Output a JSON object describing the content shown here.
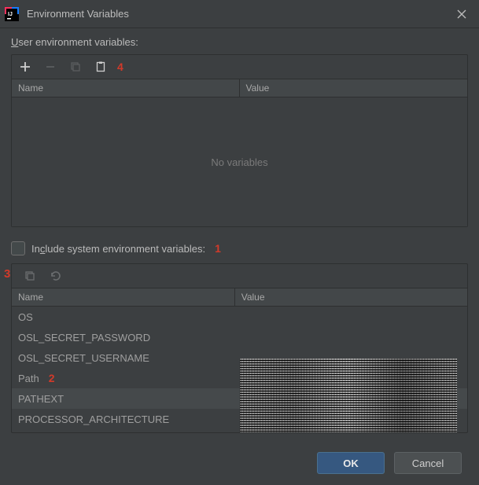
{
  "dialog": {
    "title": "Environment Variables",
    "app_icon_letters": "IJ"
  },
  "user_section": {
    "label_pre": "U",
    "label_post": "ser environment variables:",
    "columns": {
      "name": "Name",
      "value": "Value"
    },
    "empty_text": "No variables"
  },
  "include_checkbox": {
    "pre": "In",
    "underline": "c",
    "post": "lude system environment variables:"
  },
  "sys_section": {
    "columns": {
      "name": "Name",
      "value": "Value"
    },
    "rows": [
      {
        "name": "OS",
        "value": ""
      },
      {
        "name": "OSL_SECRET_PASSWORD",
        "value": ""
      },
      {
        "name": "OSL_SECRET_USERNAME",
        "value": ""
      },
      {
        "name": "Path",
        "value": ""
      },
      {
        "name": "PATHEXT",
        "value": "",
        "selected": true
      },
      {
        "name": "PROCESSOR_ARCHITECTURE",
        "value": ""
      }
    ]
  },
  "buttons": {
    "ok": "OK",
    "cancel": "Cancel"
  },
  "annotations": {
    "a1": "1",
    "a2": "2",
    "a3": "3",
    "a4": "4"
  }
}
